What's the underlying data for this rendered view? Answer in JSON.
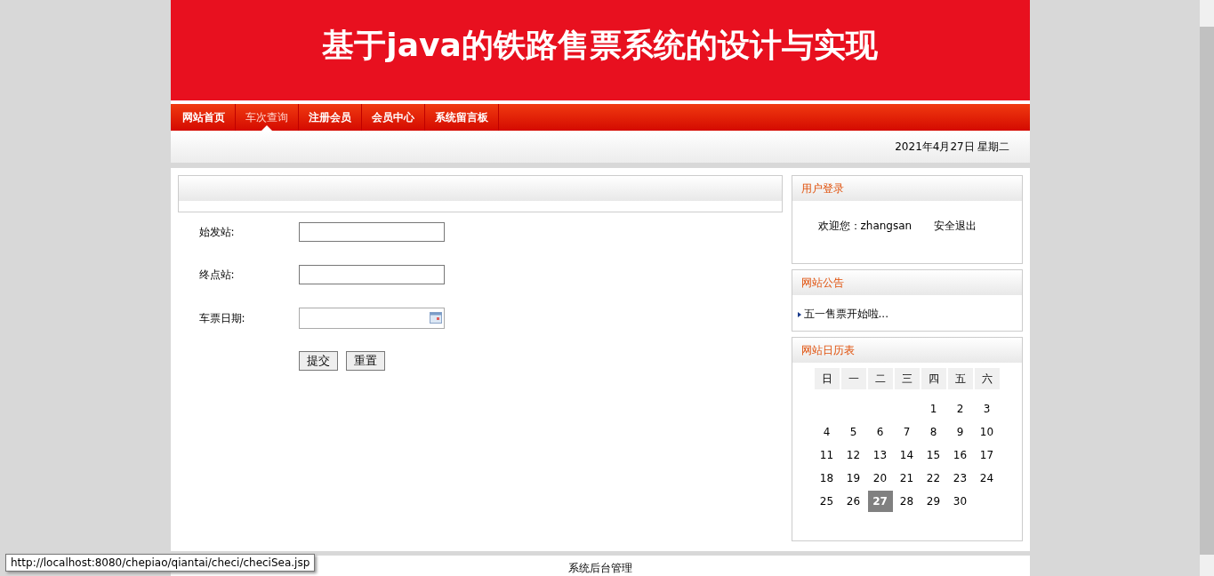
{
  "header": {
    "title": "基于java的铁路售票系统的设计与实现"
  },
  "nav": [
    {
      "label": "网站首页",
      "selected": false
    },
    {
      "label": "车次查询",
      "selected": true
    },
    {
      "label": "注册会员",
      "selected": false
    },
    {
      "label": "会员中心",
      "selected": false
    },
    {
      "label": "系统留言板",
      "selected": false
    }
  ],
  "date_bar": {
    "text": "2021年4月27日 星期二"
  },
  "form": {
    "fields": [
      {
        "label": "始发站:",
        "kind": "text"
      },
      {
        "label": "终点站:",
        "kind": "text"
      },
      {
        "label": "车票日期:",
        "kind": "date"
      }
    ],
    "buttons": [
      "提交",
      "重置"
    ]
  },
  "login_panel": {
    "title": "用户登录",
    "welcome": "欢迎您：zhangsan",
    "logout": "安全退出"
  },
  "notice_panel": {
    "title": "网站公告",
    "items": [
      "五一售票开始啦..."
    ]
  },
  "calendar_panel": {
    "title": "网站日历表",
    "weekdays": [
      "日",
      "一",
      "二",
      "三",
      "四",
      "五",
      "六"
    ],
    "weeks": [
      [
        {
          "label": "1",
          "selected": false
        },
        {
          "label": "2",
          "selected": false
        },
        {
          "label": "3",
          "selected": false
        }
      ],
      [
        {
          "label": "4",
          "selected": false
        },
        {
          "label": "5",
          "selected": false
        },
        {
          "label": "6",
          "selected": false
        },
        {
          "label": "7",
          "selected": false
        },
        {
          "label": "8",
          "selected": false
        },
        {
          "label": "9",
          "selected": false
        },
        {
          "label": "10",
          "selected": false
        }
      ],
      [
        {
          "label": "11",
          "selected": false
        },
        {
          "label": "12",
          "selected": false
        },
        {
          "label": "13",
          "selected": false
        },
        {
          "label": "14",
          "selected": false
        },
        {
          "label": "15",
          "selected": false
        },
        {
          "label": "16",
          "selected": false
        },
        {
          "label": "17",
          "selected": false
        }
      ],
      [
        {
          "label": "18",
          "selected": false
        },
        {
          "label": "19",
          "selected": false
        },
        {
          "label": "20",
          "selected": false
        },
        {
          "label": "21",
          "selected": false
        },
        {
          "label": "22",
          "selected": false
        },
        {
          "label": "23",
          "selected": false
        },
        {
          "label": "24",
          "selected": false
        }
      ],
      [
        {
          "label": "25",
          "selected": false
        },
        {
          "label": "26",
          "selected": false
        },
        {
          "label": "27",
          "selected": true
        },
        {
          "label": "28",
          "selected": false
        },
        {
          "label": "29",
          "selected": false
        },
        {
          "label": "30",
          "selected": false
        }
      ]
    ]
  },
  "footer": {
    "link": "系统后台管理"
  },
  "status_tooltip": {
    "url": "http://localhost:8080/chepiao/qiantai/checi/checiSea.jsp"
  }
}
